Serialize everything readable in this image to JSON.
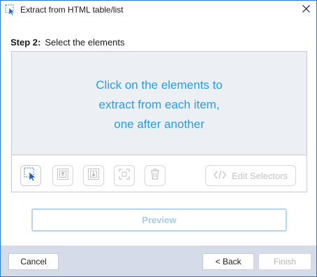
{
  "window": {
    "title": "Extract from HTML table/list",
    "app_icon": "selection-cursor-icon",
    "close_icon": "close-icon",
    "accent_color": "#2b79d6"
  },
  "step": {
    "number": "Step 2:",
    "description": "Select the elements"
  },
  "panel": {
    "message_lines": [
      "Click on the elements to",
      "extract from each item,",
      "one after another"
    ],
    "message_color": "#2b9be3",
    "toolbar": {
      "tools": [
        {
          "name": "select-element-icon",
          "enabled": true
        },
        {
          "name": "select-parent-icon",
          "enabled": false
        },
        {
          "name": "select-child-icon",
          "enabled": false
        },
        {
          "name": "focus-element-icon",
          "enabled": false
        },
        {
          "name": "delete-icon",
          "enabled": false
        }
      ],
      "edit_selectors_label": "Edit Selectors",
      "edit_selectors_icon": "code-icon"
    }
  },
  "preview": {
    "label": "Preview",
    "enabled": false
  },
  "footer": {
    "cancel_label": "Cancel",
    "back_label": "< Back",
    "finish_label": "Finish",
    "finish_enabled": false,
    "background": "#d6dbe9"
  }
}
